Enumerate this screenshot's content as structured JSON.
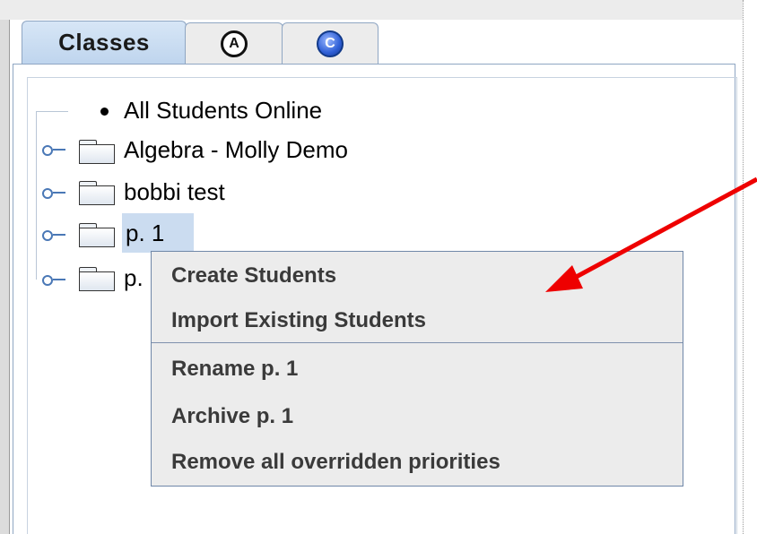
{
  "tabs": {
    "classes": "Classes",
    "a_glyph": "A",
    "c_glyph": "C"
  },
  "tree": {
    "items": [
      {
        "label": "All Students Online"
      },
      {
        "label": "Algebra - Molly Demo"
      },
      {
        "label": "bobbi test"
      },
      {
        "label": "p. 1"
      },
      {
        "label": "p."
      }
    ]
  },
  "context_menu": {
    "create_students": "Create Students",
    "import_existing_students": "Import Existing Students",
    "rename": "Rename p. 1",
    "archive": "Archive p. 1",
    "remove_overridden": "Remove all overridden priorities"
  },
  "colors": {
    "arrow": "#ee0000",
    "selection": "#cbdcf0",
    "tab_active": "#c4d9f0",
    "menu_bg": "#ececec"
  }
}
